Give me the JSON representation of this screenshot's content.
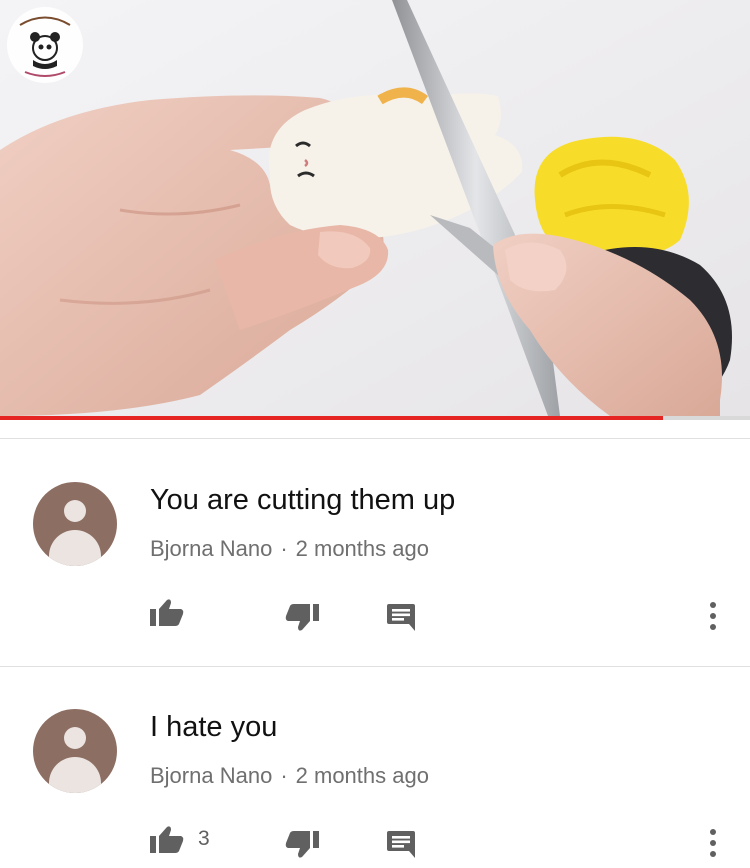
{
  "video": {
    "channel_logo": "panda-logo",
    "progress": 0.884,
    "accent_color": "#e52521"
  },
  "comments": [
    {
      "text": "You are cutting them up",
      "author": "Bjorna Nano",
      "separator": "·",
      "time": "2 months ago",
      "likes": "",
      "icons": [
        "thumb-up-icon",
        "thumb-down-icon",
        "reply-icon",
        "more-vert-icon"
      ]
    },
    {
      "text": "I hate you",
      "author": "Bjorna Nano",
      "separator": "·",
      "time": "2 months ago",
      "likes": "3",
      "icons": [
        "thumb-up-icon",
        "thumb-down-icon",
        "reply-icon",
        "more-vert-icon"
      ]
    }
  ]
}
